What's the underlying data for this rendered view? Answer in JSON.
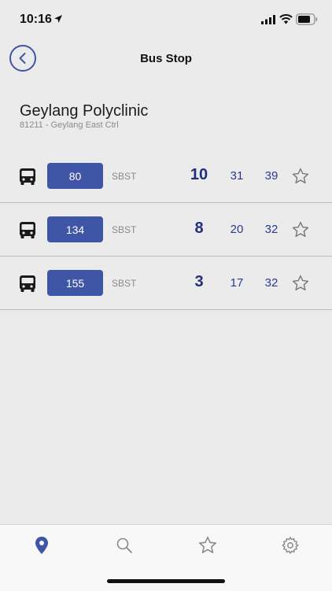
{
  "status_bar": {
    "time": "10:16",
    "icons": [
      "location-arrow-icon",
      "cellular-signal-icon",
      "wifi-icon",
      "battery-icon"
    ]
  },
  "nav": {
    "title": "Bus Stop",
    "back_icon": "chevron-left-icon"
  },
  "stop": {
    "name": "Geylang Polyclinic",
    "subtitle": "81211 - Geylang East Ctrl"
  },
  "buses": [
    {
      "route": "80",
      "operator": "SBST",
      "eta": [
        "10",
        "31",
        "39"
      ]
    },
    {
      "route": "134",
      "operator": "SBST",
      "eta": [
        "8",
        "20",
        "32"
      ]
    },
    {
      "route": "155",
      "operator": "SBST",
      "eta": [
        "3",
        "17",
        "32"
      ]
    }
  ],
  "tabs": [
    {
      "icon": "map-pin-icon",
      "active": true
    },
    {
      "icon": "search-icon",
      "active": false
    },
    {
      "icon": "star-icon",
      "active": false
    },
    {
      "icon": "gear-icon",
      "active": false
    }
  ],
  "colors": {
    "accent": "#3f55a6",
    "eta_text": "#1f2f7a",
    "background": "#ebebeb",
    "tab_bar": "#f8f8f8"
  }
}
